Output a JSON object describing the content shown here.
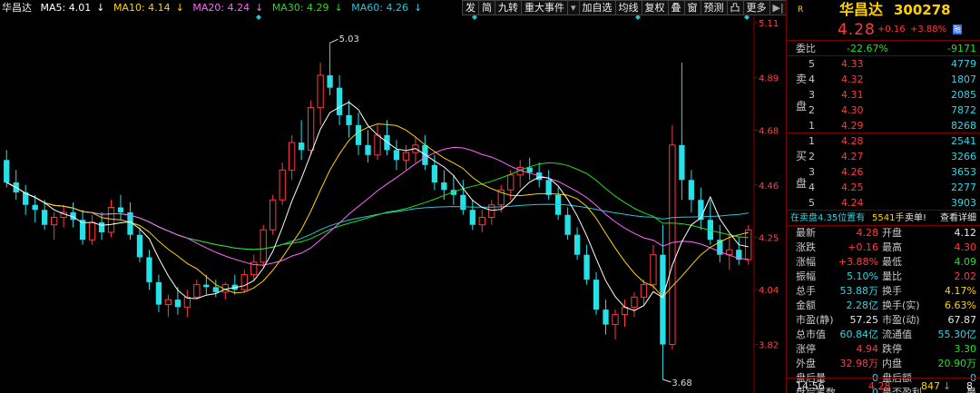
{
  "ma_legend": {
    "name": "华昌达",
    "ma5": "MA5: 4.01",
    "ma10": "MA10: 4.14",
    "ma20": "MA20: 4.24",
    "ma30": "MA30: 4.29",
    "ma60": "MA60: 4.26",
    "colors": {
      "ma5": "#ffffff",
      "ma10": "#ffd200",
      "ma20": "#ff66ff",
      "ma30": "#22dd22",
      "ma60": "#26c6da"
    }
  },
  "toolbar": [
    "发",
    "简",
    "九转",
    "重大事件",
    "加自选",
    "均线",
    "复权",
    "叠",
    "窗",
    "预测",
    "凸",
    "更多"
  ],
  "chart_data": {
    "type": "candlestick",
    "y_ticks": [
      "5.11",
      "4.89",
      "4.68",
      "4.46",
      "4.25",
      "4.04",
      "3.82"
    ],
    "y_range": [
      3.68,
      5.11
    ],
    "high_marker": "5.03",
    "low_marker": "3.68",
    "colors": {
      "up": "#ff3b3b",
      "down": "#26e0e8"
    },
    "bars": [
      [
        4.56,
        4.6,
        4.45,
        4.47
      ],
      [
        4.47,
        4.52,
        4.4,
        4.43
      ],
      [
        4.43,
        4.46,
        4.34,
        4.38
      ],
      [
        4.38,
        4.42,
        4.31,
        4.36
      ],
      [
        4.36,
        4.4,
        4.28,
        4.3
      ],
      [
        4.3,
        4.35,
        4.24,
        4.33
      ],
      [
        4.33,
        4.38,
        4.29,
        4.35
      ],
      [
        4.35,
        4.39,
        4.29,
        4.32
      ],
      [
        4.32,
        4.36,
        4.22,
        4.24
      ],
      [
        4.24,
        4.34,
        4.22,
        4.31
      ],
      [
        4.31,
        4.35,
        4.24,
        4.27
      ],
      [
        4.27,
        4.4,
        4.25,
        4.37
      ],
      [
        4.37,
        4.42,
        4.32,
        4.35
      ],
      [
        4.35,
        4.39,
        4.24,
        4.26
      ],
      [
        4.26,
        4.29,
        4.15,
        4.17
      ],
      [
        4.17,
        4.2,
        4.04,
        4.07
      ],
      [
        4.07,
        4.1,
        3.95,
        3.98
      ],
      [
        3.98,
        4.02,
        3.93,
        4.0
      ],
      [
        4.0,
        4.05,
        3.94,
        3.97
      ],
      [
        3.97,
        4.04,
        3.93,
        4.01
      ],
      [
        4.01,
        4.08,
        4.0,
        4.06
      ],
      [
        4.06,
        4.1,
        4.02,
        4.05
      ],
      [
        4.05,
        4.08,
        4.01,
        4.03
      ],
      [
        4.03,
        4.07,
        4.0,
        4.06
      ],
      [
        4.06,
        4.1,
        4.02,
        4.04
      ],
      [
        4.04,
        4.12,
        4.03,
        4.1
      ],
      [
        4.1,
        4.18,
        4.08,
        4.15
      ],
      [
        4.15,
        4.3,
        4.13,
        4.28
      ],
      [
        4.28,
        4.42,
        4.26,
        4.4
      ],
      [
        4.4,
        4.55,
        4.38,
        4.52
      ],
      [
        4.52,
        4.66,
        4.48,
        4.63
      ],
      [
        4.63,
        4.72,
        4.56,
        4.6
      ],
      [
        4.6,
        4.8,
        4.58,
        4.77
      ],
      [
        4.77,
        4.95,
        4.7,
        4.9
      ],
      [
        4.9,
        5.03,
        4.82,
        4.85
      ],
      [
        4.85,
        4.9,
        4.7,
        4.74
      ],
      [
        4.74,
        4.8,
        4.65,
        4.7
      ],
      [
        4.7,
        4.75,
        4.58,
        4.62
      ],
      [
        4.62,
        4.68,
        4.55,
        4.58
      ],
      [
        4.58,
        4.7,
        4.56,
        4.66
      ],
      [
        4.66,
        4.72,
        4.58,
        4.6
      ],
      [
        4.6,
        4.64,
        4.52,
        4.56
      ],
      [
        4.56,
        4.62,
        4.52,
        4.59
      ],
      [
        4.59,
        4.65,
        4.55,
        4.62
      ],
      [
        4.62,
        4.66,
        4.52,
        4.54
      ],
      [
        4.54,
        4.58,
        4.44,
        4.47
      ],
      [
        4.47,
        4.52,
        4.4,
        4.44
      ],
      [
        4.44,
        4.5,
        4.38,
        4.42
      ],
      [
        4.42,
        4.48,
        4.34,
        4.36
      ],
      [
        4.36,
        4.4,
        4.28,
        4.3
      ],
      [
        4.3,
        4.36,
        4.27,
        4.33
      ],
      [
        4.33,
        4.4,
        4.3,
        4.38
      ],
      [
        4.38,
        4.46,
        4.35,
        4.44
      ],
      [
        4.44,
        4.52,
        4.4,
        4.5
      ],
      [
        4.5,
        4.56,
        4.45,
        4.53
      ],
      [
        4.53,
        4.57,
        4.48,
        4.51
      ],
      [
        4.51,
        4.55,
        4.45,
        4.48
      ],
      [
        4.48,
        4.52,
        4.4,
        4.42
      ],
      [
        4.42,
        4.45,
        4.32,
        4.34
      ],
      [
        4.34,
        4.37,
        4.24,
        4.26
      ],
      [
        4.26,
        4.29,
        4.16,
        4.18
      ],
      [
        4.18,
        4.22,
        4.06,
        4.08
      ],
      [
        4.08,
        4.11,
        3.94,
        3.96
      ],
      [
        3.96,
        4.0,
        3.86,
        3.9
      ],
      [
        3.9,
        3.96,
        3.84,
        3.94
      ],
      [
        3.94,
        4.0,
        3.89,
        3.97
      ],
      [
        3.97,
        4.03,
        3.93,
        4.01
      ],
      [
        4.01,
        4.08,
        3.98,
        4.06
      ],
      [
        4.06,
        4.22,
        4.04,
        4.18
      ],
      [
        4.18,
        4.3,
        3.68,
        3.82
      ],
      [
        3.82,
        4.7,
        3.8,
        4.62
      ],
      [
        4.62,
        4.95,
        4.4,
        4.48
      ],
      [
        4.48,
        4.52,
        4.35,
        4.4
      ],
      [
        4.4,
        4.45,
        4.28,
        4.32
      ],
      [
        4.32,
        4.4,
        4.22,
        4.24
      ],
      [
        4.24,
        4.3,
        4.15,
        4.18
      ],
      [
        4.18,
        4.26,
        4.12,
        4.2
      ],
      [
        4.2,
        4.25,
        4.14,
        4.16
      ],
      [
        4.16,
        4.3,
        4.14,
        4.28
      ]
    ]
  },
  "quote": {
    "r_mark": "R",
    "name": "华昌达",
    "code": "300278",
    "price": "4.28",
    "change": "+0.16",
    "pct": "+3.88%",
    "tag": "融"
  },
  "weibi": {
    "label": "委比",
    "pct": "-22.67%",
    "diff": "-9171"
  },
  "sell": {
    "label_top": "卖",
    "label_bottom": "盘",
    "rows": [
      {
        "lv": "5",
        "price": "4.33",
        "vol": "4779"
      },
      {
        "lv": "4",
        "price": "4.32",
        "vol": "1807"
      },
      {
        "lv": "3",
        "price": "4.31",
        "vol": "2085"
      },
      {
        "lv": "2",
        "price": "4.30",
        "vol": "7872"
      },
      {
        "lv": "1",
        "price": "4.29",
        "vol": "8268"
      }
    ]
  },
  "buy": {
    "label_top": "买",
    "label_bottom": "盘",
    "rows": [
      {
        "lv": "1",
        "price": "4.28",
        "vol": "2541"
      },
      {
        "lv": "2",
        "price": "4.27",
        "vol": "3266"
      },
      {
        "lv": "3",
        "price": "4.26",
        "vol": "3653"
      },
      {
        "lv": "4",
        "price": "4.25",
        "vol": "2277"
      },
      {
        "lv": "5",
        "price": "4.24",
        "vol": "3903"
      }
    ]
  },
  "notice": {
    "text": "在卖盘4.35位置有",
    "vol": "5541手",
    "tag": "卖单!",
    "link": "查看详细"
  },
  "stats": [
    {
      "l1": "最新",
      "v1": "4.28",
      "c1": "red",
      "l2": "开盘",
      "v2": "4.12",
      "c2": "white"
    },
    {
      "l1": "涨跌",
      "v1": "+0.16",
      "c1": "red",
      "l2": "最高",
      "v2": "4.30",
      "c2": "red"
    },
    {
      "l1": "涨幅",
      "v1": "+3.88%",
      "c1": "red",
      "l2": "最低",
      "v2": "4.09",
      "c2": "green"
    },
    {
      "l1": "振幅",
      "v1": "5.10%",
      "c1": "cyan",
      "l2": "量比",
      "v2": "2.02",
      "c2": "red"
    },
    {
      "l1": "总手",
      "v1": "53.88万",
      "c1": "cyan",
      "l2": "换手",
      "v2": "4.17%",
      "c2": "yellow"
    },
    {
      "l1": "金额",
      "v1": "2.28亿",
      "c1": "cyan",
      "l2": "换手(实)",
      "v2": "6.63%",
      "c2": "yellow"
    },
    {
      "l1": "市盈(静)",
      "v1": "57.25",
      "c1": "white",
      "l2": "市盈(动)",
      "v2": "67.87",
      "c2": "white"
    },
    {
      "l1": "总市值",
      "v1": "60.84亿",
      "c1": "cyan",
      "l2": "流通值",
      "v2": "55.30亿",
      "c2": "cyan"
    },
    {
      "l1": "涨停",
      "v1": "4.94",
      "c1": "red",
      "l2": "跌停",
      "v2": "3.30",
      "c2": "green"
    },
    {
      "l1": "外盘",
      "v1": "32.98万",
      "c1": "red",
      "l2": "内盘",
      "v2": "20.90万",
      "c2": "green"
    },
    {
      "l1": "盘后量",
      "v1": "0",
      "c1": "cyan",
      "l2": "盘后额",
      "v2": "0",
      "c2": "cyan"
    },
    {
      "l1": "盘后笔数",
      "v1": "0",
      "c1": "cyan",
      "l2": "是否盈利",
      "v2": "是",
      "c2": "white"
    }
  ],
  "tick": {
    "time": "14:56",
    "price": "4.28",
    "vol": "847",
    "dir": "↓",
    "count": "8"
  }
}
